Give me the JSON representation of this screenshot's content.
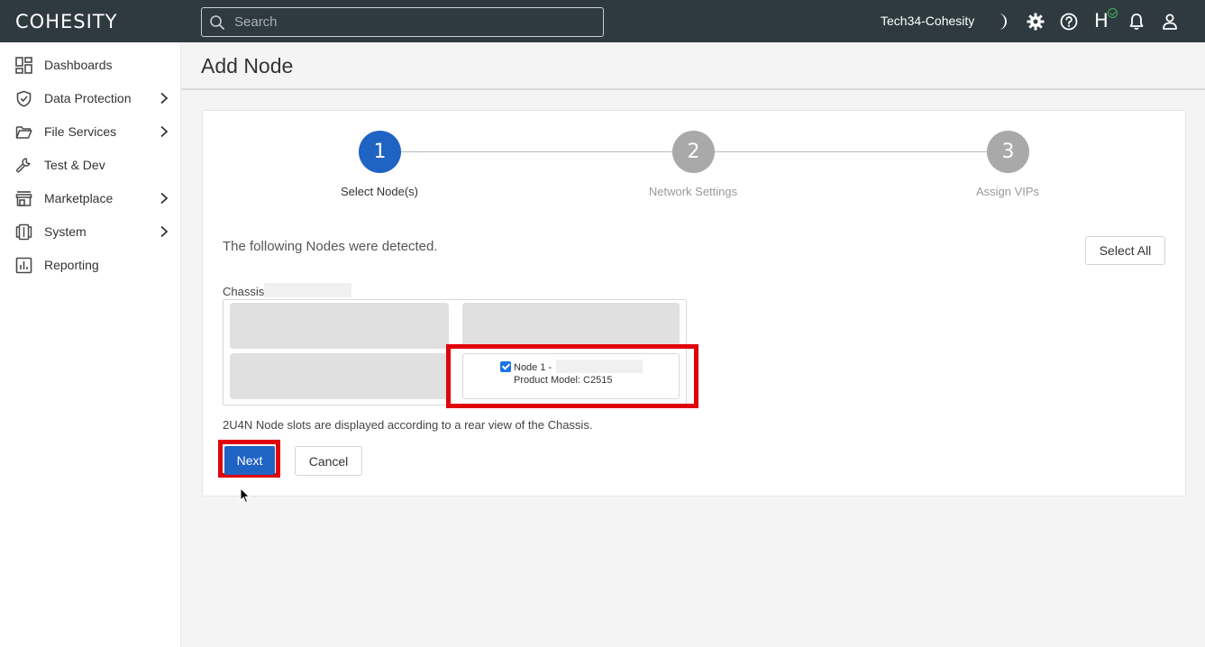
{
  "topbar": {
    "logo": "COHESITY",
    "search_placeholder": "Search",
    "cluster_name": "Tech34-Cohesity",
    "helios_label": "H"
  },
  "sidebar": {
    "items": [
      {
        "label": "Dashboards",
        "icon": "dashboard-icon",
        "has_submenu": false
      },
      {
        "label": "Data Protection",
        "icon": "shield-icon",
        "has_submenu": true
      },
      {
        "label": "File Services",
        "icon": "folder-icon",
        "has_submenu": true
      },
      {
        "label": "Test & Dev",
        "icon": "wrench-icon",
        "has_submenu": false
      },
      {
        "label": "Marketplace",
        "icon": "store-icon",
        "has_submenu": true
      },
      {
        "label": "System",
        "icon": "server-icon",
        "has_submenu": true
      },
      {
        "label": "Reporting",
        "icon": "report-icon",
        "has_submenu": false
      }
    ]
  },
  "page": {
    "title": "Add Node"
  },
  "stepper": {
    "steps": [
      {
        "number": "1",
        "label": "Select Node(s)",
        "active": true
      },
      {
        "number": "2",
        "label": "Network Settings",
        "active": false
      },
      {
        "number": "3",
        "label": "Assign VIPs",
        "active": false
      }
    ]
  },
  "content": {
    "detected_text": "The following Nodes were detected.",
    "select_all_label": "Select All",
    "chassis_label": "Chassis",
    "node": {
      "name": "Node 1 -",
      "model": "Product Model: C2515",
      "checked": true
    },
    "note": "2U4N Node slots are displayed according to a rear view of the Chassis.",
    "next_label": "Next",
    "cancel_label": "Cancel"
  },
  "colors": {
    "topbar": "#2f3a40",
    "active_step": "#1f63c3",
    "inactive_step": "#a9a9a9",
    "highlight": "#e0000b"
  }
}
